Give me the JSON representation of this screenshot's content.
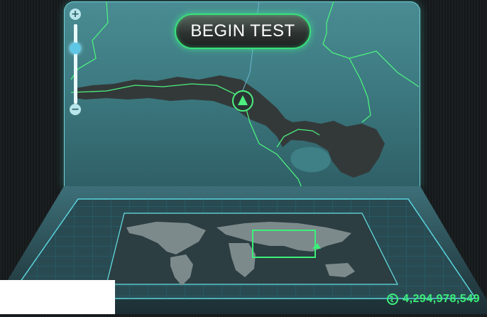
{
  "header": {
    "begin_label": "BEGIN TEST"
  },
  "zoom": {
    "plus_label": "+",
    "minus_label": "−"
  },
  "footer": {
    "server_count": "4,294,978,549",
    "icon": "globe-icon"
  },
  "colors": {
    "accent": "#3cf07a",
    "screen": "#3d7a81",
    "grid": "#1f6f7a"
  }
}
